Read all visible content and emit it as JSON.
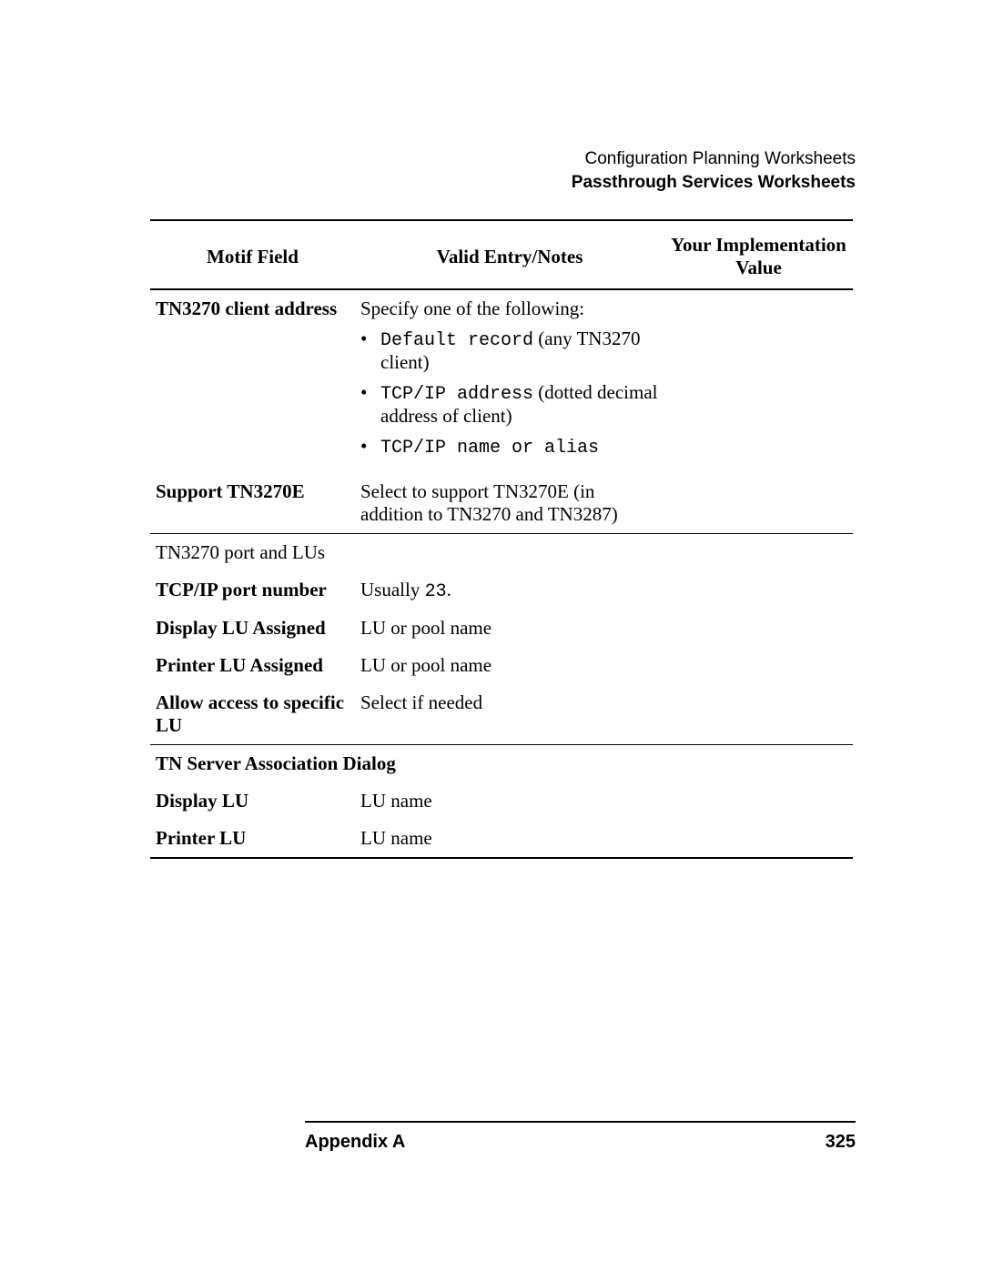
{
  "header": {
    "line1": "Configuration Planning Worksheets",
    "line2": "Passthrough Services Worksheets"
  },
  "table": {
    "headers": {
      "col1": "Motif Field",
      "col2": "Valid Entry/Notes",
      "col3": "Your Implementation Value"
    },
    "rows": {
      "r1": {
        "field": "TN3270 client address",
        "intro": "Specify one of the following:",
        "bullets": {
          "b1_mono": "Default record",
          "b1_rest": " (any TN3270 client)",
          "b2_mono": "TCP/IP address",
          "b2_rest": " (dotted decimal address of client)",
          "b3_mono": "TCP/IP name or alias",
          "b3_rest": ""
        }
      },
      "r2": {
        "field": "Support TN3270E",
        "notes": "Select to support TN3270E (in addition to TN3270 and TN3287)"
      },
      "r3": {
        "section": "TN3270 port and LUs"
      },
      "r4": {
        "field": "TCP/IP port number",
        "notes_pre": "Usually ",
        "notes_mono": "23",
        "notes_post": "."
      },
      "r5": {
        "field": "Display LU Assigned",
        "notes": "LU or pool name"
      },
      "r6": {
        "field": "Printer LU Assigned",
        "notes": "LU or pool name"
      },
      "r7": {
        "field": "Allow access to specific LU",
        "notes": "Select if needed"
      },
      "r8": {
        "section": "TN Server Association Dialog"
      },
      "r9": {
        "field": "Display LU",
        "notes": "LU name"
      },
      "r10": {
        "field": "Printer LU",
        "notes": "LU name"
      }
    }
  },
  "footer": {
    "left": "Appendix A",
    "right": "325"
  }
}
